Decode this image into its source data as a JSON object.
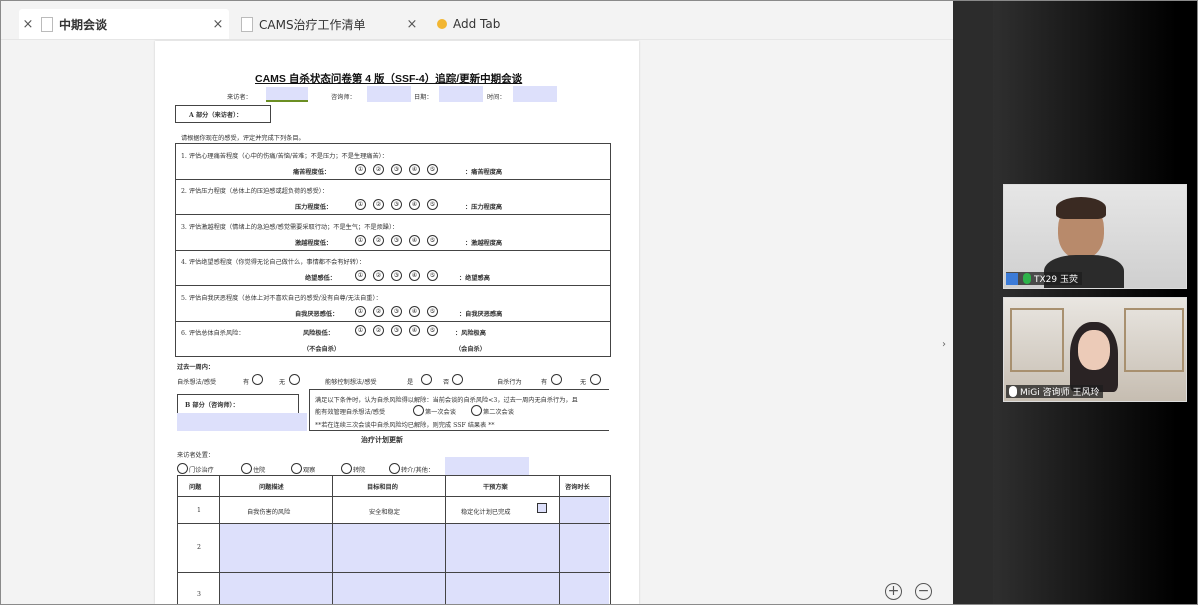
{
  "tabs": [
    {
      "label": "中期会谈",
      "active": true
    },
    {
      "label": "CAMS治疗工作清单",
      "active": false
    },
    {
      "label": "Add Tab",
      "active": false
    }
  ],
  "document": {
    "title": "CAMS 自杀状态问卷第 4 版（SSF-4）追踪/更新中期会谈",
    "header_fields": {
      "visitor": "来访者：",
      "counselor": "咨询师：",
      "date": "日期：",
      "time": "时间："
    },
    "part_a": "A 部分（来访者）：",
    "instruction": "请根据你现在的感受，评定并完成下列条目。",
    "items": [
      {
        "text": "1. 评估心理痛苦程度（心中的伤痛/苦恼/苦难；不是压力；不是生理痛苦）：",
        "low": "痛苦程度低：",
        "high": "：痛苦程度高"
      },
      {
        "text": "2. 评估压力程度（总体上的压迫感或超负荷的感受）：",
        "low": "压力程度低：",
        "high": "：压力程度高"
      },
      {
        "text": "3. 评估激越程度（情绪上的急迫感/感觉需要采取行动；不是生气；不是烦躁）：",
        "low": "激越程度低：",
        "high": "：激越程度高"
      },
      {
        "text": "4. 评估绝望感程度（你觉得无论自己做什么，事情都不会有好转）：",
        "low": "绝望感低：",
        "high": "：绝望感高"
      },
      {
        "text": "5. 评估自我厌恶程度（总体上对不喜欢自己的感受/没有自尊/无法自重）：",
        "low": "自我厌恶感低：",
        "high": "：自我厌恶感高"
      },
      {
        "text": "6. 评估总体自杀风险：",
        "low": "风险极低：",
        "high": "：风险极高",
        "low_note": "（不会自杀）",
        "high_note": "（会自杀）"
      }
    ],
    "scale": [
      "①",
      "②",
      "③",
      "④",
      "⑤"
    ],
    "past_week": {
      "label": "过去一周内：",
      "q1": "自杀想法/感受",
      "q2": "能够控制想法/感受",
      "q3": "自杀行为",
      "yes": "有",
      "no": "无",
      "yes2": "是",
      "no2": "否"
    },
    "part_b": "B 部分（咨询师）：",
    "resolution_note_1": "满足以下条件时，认为自杀风险得以解除：当前会谈的自杀风险<3，过去一周内无自杀行为，且",
    "resolution_note_2": "能有效管理自杀想法/感受",
    "first_session": "第一次会谈",
    "second_session": "第二次会谈",
    "resolution_note_3": "**若在连续三次会谈中自杀风险均已解除，则完成 SSF 结果表 **",
    "plan_title": "治疗计划更新",
    "disposition_label": "来访者处置：",
    "dispositions": [
      "门诊治疗",
      "住院",
      "观察",
      "转院",
      "转介/其他："
    ],
    "table": {
      "headers": [
        "问题",
        "问题描述",
        "目标和目的",
        "干预方案",
        "咨询时长"
      ],
      "rows": [
        {
          "num": "1",
          "desc": "自我伤害的风险",
          "goal": "安全和稳定",
          "plan": "稳定化计划已完成"
        },
        {
          "num": "2",
          "desc": "",
          "goal": "",
          "plan": ""
        },
        {
          "num": "3",
          "desc": "",
          "goal": "",
          "plan": ""
        }
      ]
    }
  },
  "zoom": {
    "in": "+",
    "out": "−"
  },
  "participants": [
    {
      "name": "TX29 玉荧",
      "mic": "active"
    },
    {
      "name": "MiGi 咨询师 王风玲",
      "mic": "muted"
    }
  ],
  "colors": {
    "field_fill": "#dde0fb",
    "panel_dark": "#1a1a1a",
    "accent_bulb": "#f2b632"
  }
}
